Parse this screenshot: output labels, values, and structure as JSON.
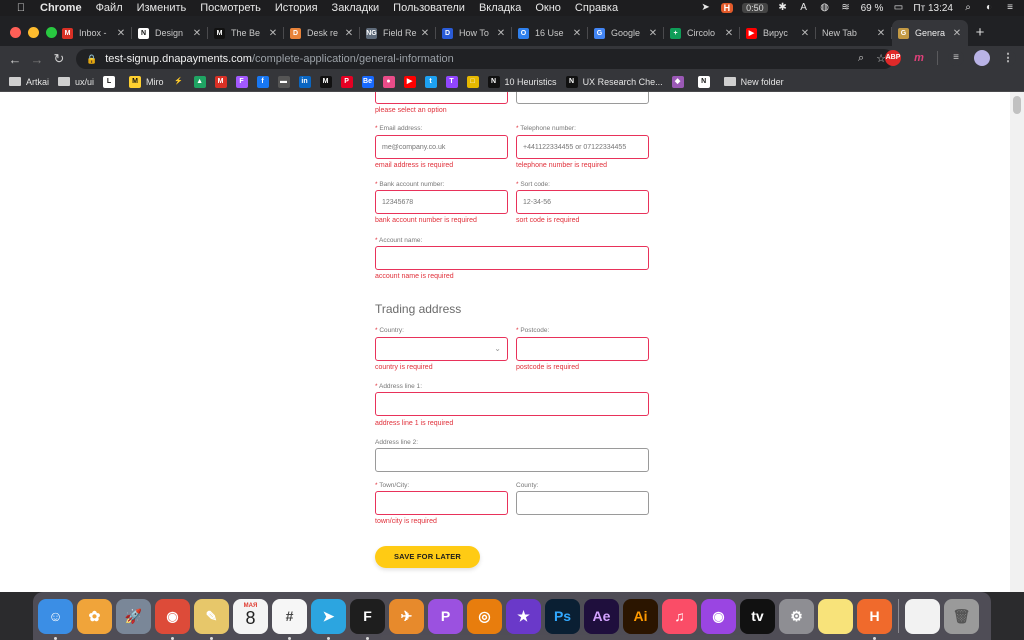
{
  "menubar": {
    "app": "Chrome",
    "items": [
      "Файл",
      "Изменить",
      "Посмотреть",
      "История",
      "Закладки",
      "Пользователи",
      "Вкладка",
      "Окно",
      "Справка"
    ],
    "timer": "0:50",
    "timer_badge": "H",
    "battery": "69 %",
    "clock": "Пт 13:24"
  },
  "tabs": [
    {
      "title": "Inbox -",
      "icon": "gmail-icon",
      "color": "#d93025",
      "glyph": "M"
    },
    {
      "title": "Design",
      "icon": "notion-icon",
      "color": "#ffffff",
      "glyph": "N"
    },
    {
      "title": "The Be",
      "icon": "medium-icon",
      "color": "#111111",
      "glyph": "M"
    },
    {
      "title": "Desk re",
      "icon": "page-icon",
      "color": "#e8833a",
      "glyph": "D"
    },
    {
      "title": "Field Re",
      "icon": "nng-icon",
      "color": "#5f6b7a",
      "glyph": "NG"
    },
    {
      "title": "How To",
      "icon": "site-icon",
      "color": "#2a5bd7",
      "glyph": "D"
    },
    {
      "title": "16 Use",
      "icon": "circle-icon",
      "color": "#2f80ed",
      "glyph": "O"
    },
    {
      "title": "Google",
      "icon": "google-docs-icon",
      "color": "#4285f4",
      "glyph": "G"
    },
    {
      "title": "Circolo",
      "icon": "sheets-icon",
      "color": "#0f9d58",
      "glyph": "+"
    },
    {
      "title": "Вирус",
      "icon": "youtube-icon",
      "color": "#ff0000",
      "glyph": "▶"
    },
    {
      "title": "New Tab",
      "icon": "none",
      "color": "",
      "glyph": ""
    },
    {
      "title": "Genera",
      "icon": "dna-icon",
      "color": "#c49a44",
      "glyph": "G",
      "active": true
    }
  ],
  "toolbar": {
    "url_host": "test-signup.dnapayments.com",
    "url_path": "/complete-application/general-information"
  },
  "bookmarks": {
    "items": [
      {
        "label": "Artkai",
        "type": "folder"
      },
      {
        "label": "ux/ui",
        "type": "folder"
      },
      {
        "label": "",
        "type": "icon",
        "color": "#ffffff",
        "glyph": "L"
      },
      {
        "label": "Miro",
        "type": "site",
        "color": "#ffd02f",
        "glyph": "M"
      }
    ],
    "icons": [
      {
        "name": "bolt-icon",
        "color": "#35363a",
        "glyph": "⚡"
      },
      {
        "name": "drive-icon",
        "color": "#1fa463",
        "glyph": "▲"
      },
      {
        "name": "gmail-icon",
        "color": "#d93025",
        "glyph": "M"
      },
      {
        "name": "figma-icon",
        "color": "#a259ff",
        "glyph": "F"
      },
      {
        "name": "facebook-icon",
        "color": "#1877f2",
        "glyph": "f"
      },
      {
        "name": "bar-icon",
        "color": "#555555",
        "glyph": "▬"
      },
      {
        "name": "linkedin-icon",
        "color": "#0a66c2",
        "glyph": "in"
      },
      {
        "name": "medium-icon",
        "color": "#111111",
        "glyph": "M"
      },
      {
        "name": "pinterest-icon",
        "color": "#e60023",
        "glyph": "P"
      },
      {
        "name": "behance-icon",
        "color": "#1769ff",
        "glyph": "Be"
      },
      {
        "name": "dribbble-icon",
        "color": "#ea4c89",
        "glyph": "●"
      },
      {
        "name": "youtube-icon",
        "color": "#ff0000",
        "glyph": "▶"
      },
      {
        "name": "twitter-icon",
        "color": "#1da1f2",
        "glyph": "t"
      },
      {
        "name": "twitch-icon",
        "color": "#9146ff",
        "glyph": "T"
      },
      {
        "name": "box-icon",
        "color": "#e6b800",
        "glyph": "□"
      }
    ],
    "tail": [
      {
        "label": "10 Heuristics",
        "color": "#111111",
        "glyph": "N"
      },
      {
        "label": "UX Research Che...",
        "color": "#111111",
        "glyph": "N"
      },
      {
        "label": "",
        "color": "#9b59b6",
        "glyph": "◆"
      },
      {
        "label": "",
        "color": "#ffffff",
        "glyph": "N"
      },
      {
        "label": "New folder",
        "type": "folder"
      }
    ]
  },
  "form": {
    "prev_error": "please select an option",
    "email": {
      "label": "Email address",
      "placeholder": "me@company.co.uk",
      "error": "email address is required"
    },
    "phone": {
      "label": "Telephone number",
      "placeholder": "+441122334455 or 07122334455",
      "error": "telephone number is required"
    },
    "bank_account": {
      "label": "Bank account number",
      "placeholder": "12345678",
      "error": "bank account number is required"
    },
    "sort_code": {
      "label": "Sort code",
      "placeholder": "12-34-56",
      "error": "sort code is required"
    },
    "account_name": {
      "label": "Account name",
      "placeholder": "",
      "error": "account name is required"
    },
    "trading_title": "Trading address",
    "country": {
      "label": "Country",
      "value": "",
      "error": "country is required"
    },
    "postcode": {
      "label": "Postcode",
      "placeholder": "",
      "error": "postcode is required"
    },
    "address1": {
      "label": "Address line 1",
      "placeholder": "",
      "error": "address line 1 is required"
    },
    "address2": {
      "label": "Address line 2",
      "placeholder": ""
    },
    "town": {
      "label": "Town/City",
      "placeholder": "",
      "error": "town/city is required"
    },
    "county": {
      "label": "County",
      "placeholder": ""
    },
    "required_mark": "*",
    "save_label": "SAVE FOR LATER"
  },
  "dock": {
    "calendar_month": "МАЯ",
    "calendar_day": "8",
    "apps": [
      {
        "name": "finder-icon",
        "color": "#3b8ee5",
        "glyph": "☺",
        "dot": true
      },
      {
        "name": "photos-icon",
        "color": "#f0a43a",
        "glyph": "✿",
        "dot": false
      },
      {
        "name": "launchpad-icon",
        "color": "#7a8798",
        "glyph": "🚀",
        "dot": false
      },
      {
        "name": "chrome-icon",
        "color": "#dd4b39",
        "glyph": "◉",
        "dot": true
      },
      {
        "name": "notes-icon",
        "color": "#e7c76a",
        "glyph": "✎",
        "dot": true
      },
      {
        "name": "calendar-icon",
        "color": "#f4f4f4",
        "glyph": "",
        "dot": false
      },
      {
        "name": "slack-icon",
        "color": "#f6f6f6",
        "glyph": "#",
        "dot": true
      },
      {
        "name": "telegram-icon",
        "color": "#2ca5e0",
        "glyph": "➤",
        "dot": true
      },
      {
        "name": "figma-icon",
        "color": "#1e1e1e",
        "glyph": "F",
        "dot": true
      },
      {
        "name": "kite-icon",
        "color": "#e78a2c",
        "glyph": "✈",
        "dot": false
      },
      {
        "name": "pockity-icon",
        "color": "#9b51e0",
        "glyph": "P",
        "dot": false
      },
      {
        "name": "blender-icon",
        "color": "#e87d0d",
        "glyph": "◎",
        "dot": false
      },
      {
        "name": "imovie-icon",
        "color": "#6a39c9",
        "glyph": "★",
        "dot": false
      },
      {
        "name": "photoshop-icon",
        "color": "#0a1f33",
        "glyph": "Ps",
        "dot": false
      },
      {
        "name": "after-effects-icon",
        "color": "#1f0f3d",
        "glyph": "Ae",
        "dot": false
      },
      {
        "name": "illustrator-icon",
        "color": "#2b1500",
        "glyph": "Ai",
        "dot": false
      },
      {
        "name": "music-icon",
        "color": "#fa4d67",
        "glyph": "♫",
        "dot": false
      },
      {
        "name": "podcasts-icon",
        "color": "#9a45e2",
        "glyph": "◉",
        "dot": false
      },
      {
        "name": "apple-tv-icon",
        "color": "#111111",
        "glyph": "tv",
        "dot": false
      },
      {
        "name": "system-preferences-icon",
        "color": "#8e8e93",
        "glyph": "⚙",
        "dot": false
      },
      {
        "name": "stickies-icon",
        "color": "#f8e37a",
        "glyph": "",
        "dot": false
      },
      {
        "name": "hours-icon",
        "color": "#f06a2c",
        "glyph": "H",
        "dot": true
      }
    ],
    "trailing": [
      {
        "name": "document-icon",
        "color": "#f2f2f2",
        "glyph": ""
      },
      {
        "name": "trash-icon",
        "color": "#9a9a9a",
        "glyph": "🗑"
      }
    ]
  }
}
